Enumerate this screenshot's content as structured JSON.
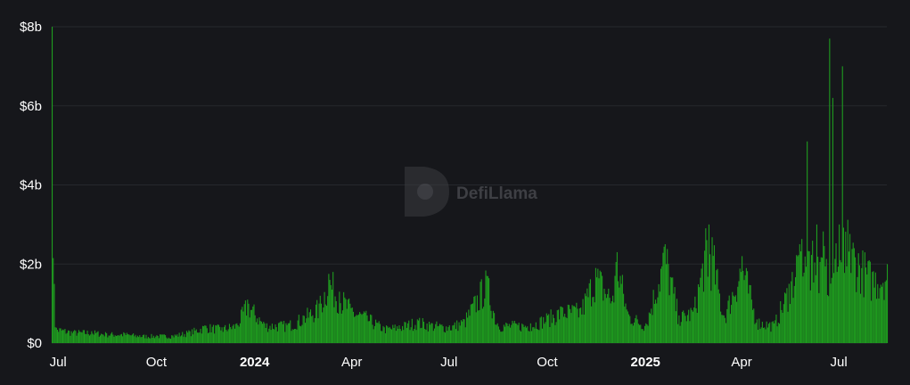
{
  "chart_data": {
    "type": "bar",
    "title": "",
    "xlabel": "",
    "ylabel": "",
    "ylim": [
      0,
      8000000000
    ],
    "x_range": [
      "2023-06-25",
      "2025-08-15"
    ],
    "grid": true,
    "color": "#1f9e1f",
    "y_ticks": [
      {
        "value": 0,
        "label": "$0"
      },
      {
        "value": 2000000000,
        "label": "$2b"
      },
      {
        "value": 4000000000,
        "label": "$4b"
      },
      {
        "value": 6000000000,
        "label": "$6b"
      },
      {
        "value": 8000000000,
        "label": "$8b"
      }
    ],
    "x_ticks": [
      {
        "date": "2023-07-01",
        "label": "Jul",
        "bold": false
      },
      {
        "date": "2023-10-01",
        "label": "Oct",
        "bold": false
      },
      {
        "date": "2024-01-01",
        "label": "2024",
        "bold": true
      },
      {
        "date": "2024-04-01",
        "label": "Apr",
        "bold": false
      },
      {
        "date": "2024-07-01",
        "label": "Jul",
        "bold": false
      },
      {
        "date": "2024-10-01",
        "label": "Oct",
        "bold": false
      },
      {
        "date": "2025-01-01",
        "label": "2025",
        "bold": true
      },
      {
        "date": "2025-04-01",
        "label": "Apr",
        "bold": false
      },
      {
        "date": "2025-07-01",
        "label": "Jul",
        "bold": false
      }
    ],
    "series": [
      {
        "points": [
          [
            "2023-06-25",
            8000000000
          ],
          [
            "2023-06-28",
            400000000
          ],
          [
            "2023-07-15",
            300000000
          ],
          [
            "2023-08-01",
            300000000
          ],
          [
            "2023-08-15",
            250000000
          ],
          [
            "2023-09-01",
            250000000
          ],
          [
            "2023-09-15",
            200000000
          ],
          [
            "2023-10-01",
            200000000
          ],
          [
            "2023-10-15",
            200000000
          ],
          [
            "2023-11-01",
            300000000
          ],
          [
            "2023-11-15",
            450000000
          ],
          [
            "2023-12-01",
            400000000
          ],
          [
            "2023-12-15",
            500000000
          ],
          [
            "2023-12-25",
            1100000000
          ],
          [
            "2024-01-10",
            500000000
          ],
          [
            "2024-02-01",
            500000000
          ],
          [
            "2024-02-15",
            700000000
          ],
          [
            "2024-03-01",
            1000000000
          ],
          [
            "2024-03-10",
            1750000000
          ],
          [
            "2024-03-20",
            1300000000
          ],
          [
            "2024-04-01",
            900000000
          ],
          [
            "2024-04-15",
            700000000
          ],
          [
            "2024-05-01",
            400000000
          ],
          [
            "2024-05-15",
            450000000
          ],
          [
            "2024-06-01",
            600000000
          ],
          [
            "2024-06-15",
            500000000
          ],
          [
            "2024-07-01",
            450000000
          ],
          [
            "2024-07-15",
            600000000
          ],
          [
            "2024-08-05",
            1700000000
          ],
          [
            "2024-08-15",
            500000000
          ],
          [
            "2024-09-01",
            500000000
          ],
          [
            "2024-09-15",
            500000000
          ],
          [
            "2024-10-01",
            700000000
          ],
          [
            "2024-10-15",
            900000000
          ],
          [
            "2024-11-01",
            900000000
          ],
          [
            "2024-11-15",
            1900000000
          ],
          [
            "2024-12-01",
            1200000000
          ],
          [
            "2024-12-05",
            2300000000
          ],
          [
            "2024-12-15",
            800000000
          ],
          [
            "2025-01-01",
            500000000
          ],
          [
            "2025-01-19",
            2500000000
          ],
          [
            "2025-02-01",
            700000000
          ],
          [
            "2025-02-15",
            900000000
          ],
          [
            "2025-03-01",
            3000000000
          ],
          [
            "2025-03-15",
            700000000
          ],
          [
            "2025-04-01",
            2200000000
          ],
          [
            "2025-04-15",
            600000000
          ],
          [
            "2025-05-01",
            500000000
          ],
          [
            "2025-05-15",
            1500000000
          ],
          [
            "2025-05-25",
            2500000000
          ],
          [
            "2025-06-01",
            5100000000
          ],
          [
            "2025-06-10",
            3000000000
          ],
          [
            "2025-06-22",
            7700000000
          ],
          [
            "2025-06-25",
            6200000000
          ],
          [
            "2025-07-01",
            3000000000
          ],
          [
            "2025-07-04",
            7000000000
          ],
          [
            "2025-07-15",
            2400000000
          ],
          [
            "2025-08-01",
            1800000000
          ],
          [
            "2025-08-15",
            2000000000
          ]
        ]
      }
    ]
  },
  "watermark": {
    "text": "DefiLlama",
    "icon": "llama-logo-icon"
  }
}
